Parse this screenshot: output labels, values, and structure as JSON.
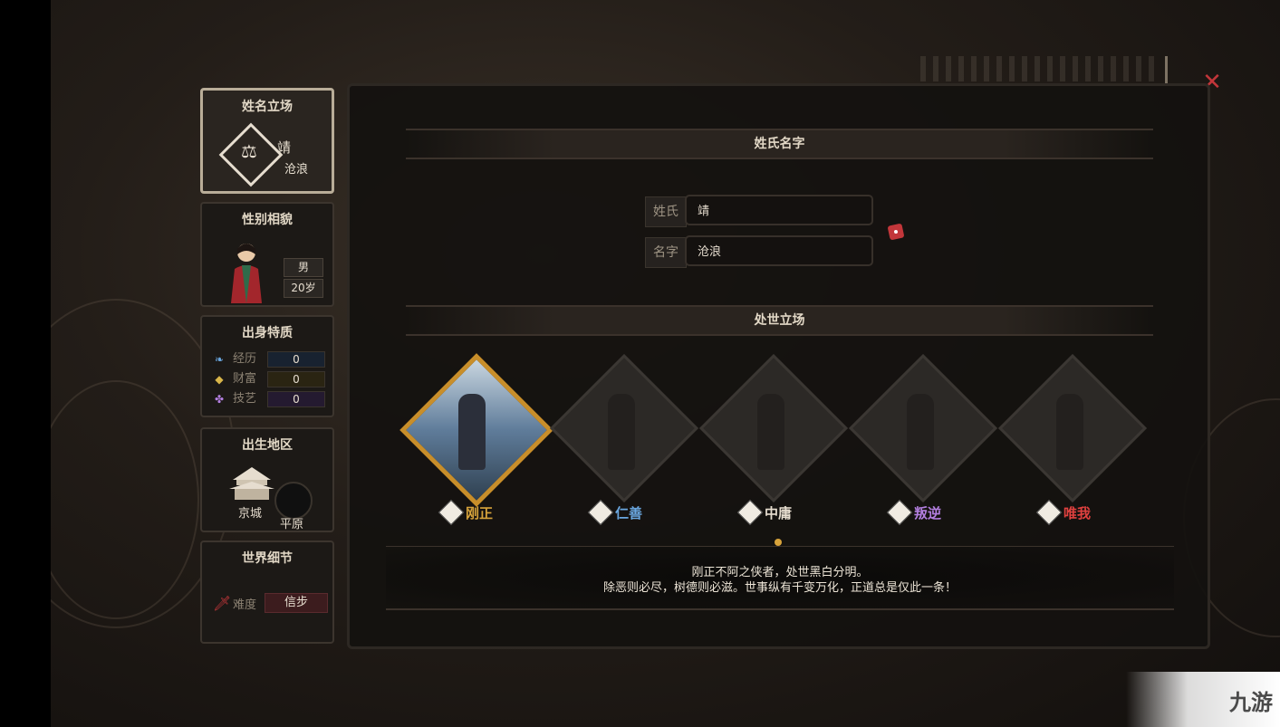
{
  "close_icon": "close-x",
  "sidebar": {
    "name_card": {
      "title": "姓名立场",
      "surname": "靖",
      "given_name": "沧浪"
    },
    "gender_card": {
      "title": "性别相貌",
      "gender": "男",
      "age": "20岁"
    },
    "trait_card": {
      "title": "出身特质",
      "rows": [
        {
          "label": "经历",
          "value": "0",
          "color": "#6aa7e0"
        },
        {
          "label": "财富",
          "value": "0",
          "color": "#d9b64a"
        },
        {
          "label": "技艺",
          "value": "0",
          "color": "#b37fe0"
        }
      ]
    },
    "region_card": {
      "title": "出生地区",
      "city": "京城",
      "terrain": "平原"
    },
    "world_card": {
      "title": "世界细节",
      "difficulty_label": "难度",
      "difficulty_value": "信步"
    }
  },
  "main": {
    "name_section_title": "姓氏名字",
    "surname_label": "姓氏",
    "surname_value": "靖",
    "given_label": "名字",
    "given_value": "沧浪",
    "stance_section_title": "处世立场",
    "stances": [
      {
        "name": "刚正",
        "color": "#d7a33b",
        "selected": true
      },
      {
        "name": "仁善",
        "color": "#6aa7e0",
        "selected": false
      },
      {
        "name": "中庸",
        "color": "#e6ddcf",
        "selected": false
      },
      {
        "name": "叛逆",
        "color": "#b37fe0",
        "selected": false
      },
      {
        "name": "唯我",
        "color": "#e0413f",
        "selected": false
      }
    ],
    "description_line1": "刚正不阿之侠者，处世黑白分明。",
    "description_line2": "除恶则必尽，树德则必滋。世事纵有千变万化，正道总是仅此一条！"
  },
  "watermark": {
    "text": "九游"
  }
}
